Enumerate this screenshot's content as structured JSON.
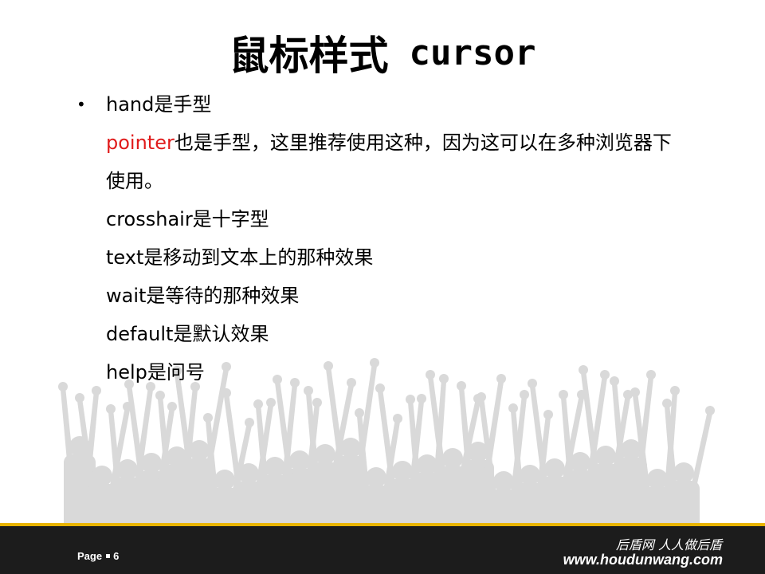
{
  "slide": {
    "title_cn": "鼠标样式",
    "title_en": "cursor",
    "bullet_symbol": "•",
    "lines": [
      {
        "text": "hand是手型"
      },
      {
        "highlight": "pointer",
        "text": "也是手型，这里推荐使用这种，因为这可以在多种浏览器下"
      },
      {
        "text": "使用。"
      },
      {
        "text": "crosshair是十字型"
      },
      {
        "text": "text是移动到文本上的那种效果"
      },
      {
        "text": "wait是等待的那种效果"
      },
      {
        "text": "default是默认效果"
      },
      {
        "text": "help是问号"
      }
    ]
  },
  "footer": {
    "page_label": "Page",
    "page_number": "6",
    "slogan": "后盾网 人人做后盾",
    "website": "www.houdunwang.com"
  },
  "colors": {
    "highlight": "#e01b1b",
    "footer_bg": "#1c1c1c",
    "accent_line": "#e8b400",
    "crowd_silhouette": "#d9d9d9"
  },
  "decorations": {
    "background_graphic": "crowd-silhouette"
  }
}
